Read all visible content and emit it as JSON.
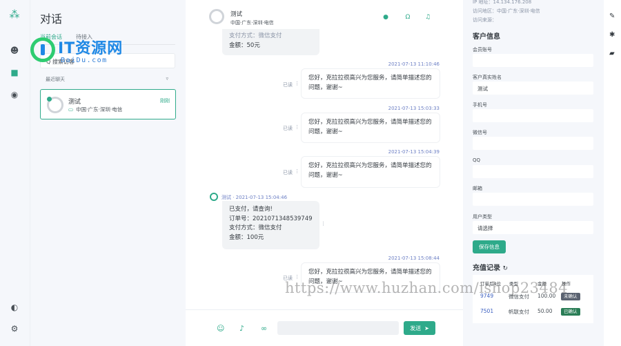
{
  "sidebar": {
    "icons": [
      "logo-icon",
      "avatar-icon",
      "chat-icon",
      "user-icon",
      "moon-icon",
      "gear-icon"
    ]
  },
  "conversations": {
    "title": "对话",
    "tabs": [
      "当前会话",
      "待接入"
    ],
    "search_placeholder": "Q 搜索访客",
    "recent_label": "最近聊天",
    "item": {
      "name": "测试",
      "location": "中国·广东·深圳·电信",
      "time": "刚刚"
    }
  },
  "watermark": {
    "brand": "IT资源网",
    "domain": "BaiDu.com",
    "url": "https://www.huzhan.com/ishop23484"
  },
  "chat": {
    "header_name": "测试",
    "header_location": "中国·广东·深圳·电信",
    "partial_top_text": "支付方式：微信支付",
    "partial_top_amount": "金额：50元",
    "messages": [
      {
        "time": "2021-07-13 11:10:46",
        "status": "已读",
        "text": "您好，克拉拉很高兴为您服务，请简单描述您的问题，谢谢~"
      },
      {
        "time": "2021-07-13 15:03:33",
        "status": "已读",
        "text": "您好，克拉拉很高兴为您服务，请简单描述您的问题，谢谢~"
      },
      {
        "time": "2021-07-13 15:04:39",
        "status": "已读",
        "text": "您好，克拉拉很高兴为您服务，请简单描述您的问题，谢谢~"
      }
    ],
    "incoming": {
      "meta": "测试 · 2021-07-13 15:04:46",
      "lines": [
        "已支付，请查询!",
        "订单号：2021071348539749",
        "支付方式：微信支付",
        "金额：100元"
      ]
    },
    "last": {
      "time": "2021-07-13 15:08:44",
      "status": "已读",
      "text": "您好，克拉拉很高兴为您服务，请简单描述您的问题，谢谢~"
    },
    "send_label": "发送"
  },
  "customer": {
    "top_ip": "IP 地址：14.134.176.208",
    "top_region": "访问地区：中国·广东·深圳·电信",
    "top_source": "访问来源：",
    "section_title": "客户信息",
    "fields": [
      {
        "label": "会员账号",
        "value": ""
      },
      {
        "label": "客户真实姓名",
        "value": "测试"
      },
      {
        "label": "手机号",
        "value": ""
      },
      {
        "label": "微信号",
        "value": ""
      },
      {
        "label": "QQ",
        "value": ""
      },
      {
        "label": "邮箱",
        "value": ""
      },
      {
        "label": "用户类型",
        "value": "请选择"
      }
    ],
    "save_label": "保存信息",
    "recharge_title": "充值记录",
    "recharge_headers": [
      "订单后4位",
      "类型",
      "金额",
      "操作"
    ],
    "recharge_rows": [
      {
        "order": "9749",
        "type": "微信支付",
        "amount": "100.00",
        "action": "未确认"
      },
      {
        "order": "7501",
        "type": "帆联支付",
        "amount": "50.00",
        "action": "已确认"
      }
    ]
  }
}
